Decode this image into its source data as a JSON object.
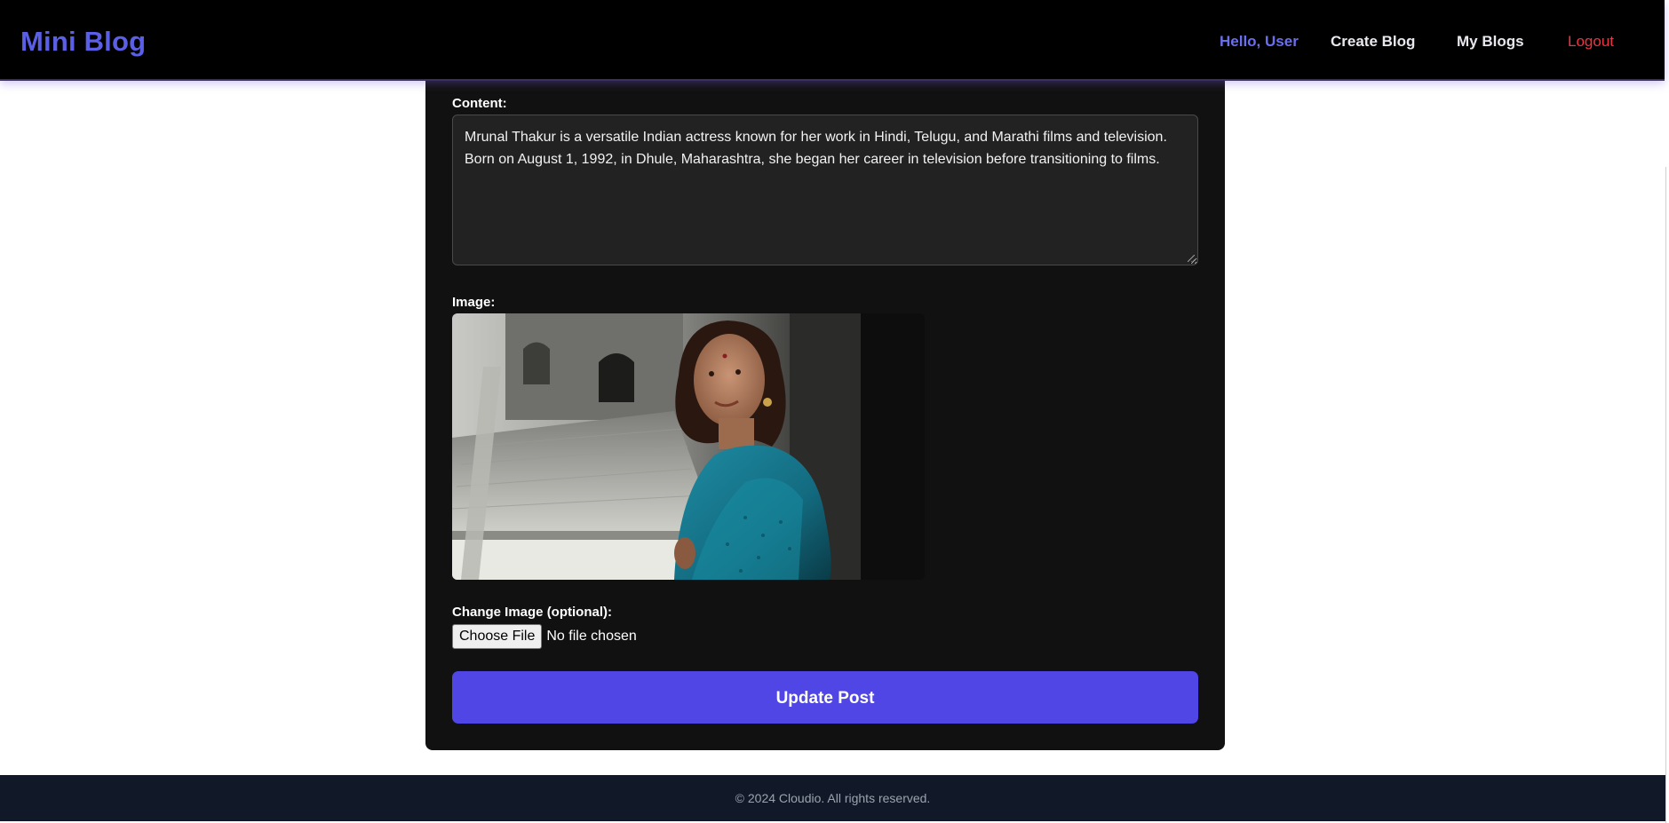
{
  "header": {
    "brand": "Mini Blog",
    "greeting": "Hello, User",
    "nav": {
      "create": "Create Blog",
      "my_blogs": "My Blogs",
      "logout": "Logout"
    }
  },
  "form": {
    "content_label": "Content:",
    "content_value": "Mrunal Thakur is a versatile Indian actress known for her work in Hindi, Telugu, and Marathi films and television. Born on August 1, 1992, in Dhule, Maharashtra, she began her career in television before transitioning to films.",
    "image_label": "Image:",
    "image_alt": "Blog post image",
    "change_image_label": "Change Image (optional):",
    "file_button": "Choose File",
    "file_status": "No file chosen",
    "submit_label": "Update Post"
  },
  "footer": {
    "copyright": "© 2024 Cloudio. All rights reserved."
  },
  "colors": {
    "navbar_bg": "#000000",
    "brand": "#5b5fe6",
    "greeting": "#6a6ff0",
    "logout": "#ef3340",
    "card_bg": "#111111",
    "button_primary": "#4f46e5",
    "footer_bg": "#111827"
  }
}
